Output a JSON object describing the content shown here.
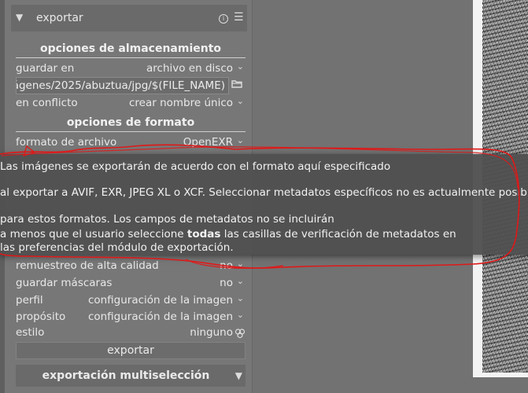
{
  "module": {
    "title": "exportar",
    "collapse_arrow": "▼"
  },
  "storage": {
    "section_title": "opciones de almacenamiento",
    "target_label": "guardar en",
    "target_value": "archivo en disco",
    "path_value": "ágenes/2025/abuztua/jpg/$(FILE_NAME)",
    "conflict_label": "en conflicto",
    "conflict_value": "crear nombre único"
  },
  "format": {
    "section_title": "opciones de formato",
    "file_format_label": "formato de archivo",
    "file_format_value": "OpenEXR"
  },
  "tooltip": {
    "line1": "Las imágenes se exportarán de acuerdo con el formato aquí especificado",
    "line2": "al exportar a AVIF, EXR, JPEG XL o XCF. Seleccionar metadatos específicos no es actualmente posible",
    "line3": "para estos formatos. Los campos de metadatos no se incluirán",
    "line4_before": "a menos que el usuario seleccione ",
    "line4_bold": "todas",
    "line4_after": " las casillas de verificación de metadatos en",
    "line5": "las preferencias del módulo de exportación."
  },
  "settings": {
    "hq_label": "remuestreo de alta calidad",
    "hq_value": "no",
    "masks_label": "guardar máscaras",
    "masks_value": "no",
    "profile_label": "perfil",
    "profile_value": "configuración de la imagen",
    "intent_label": "propósito",
    "intent_value": "configuración de la imagen",
    "style_label": "estilo",
    "style_value": "ninguno"
  },
  "export_button": "exportar",
  "multi": {
    "title": "exportación multiselección",
    "tri": "▼"
  },
  "colors": {
    "annotation_red": "#e01818",
    "panel_bg": "#777777"
  },
  "icons": [
    "info-icon",
    "menu-icon",
    "folder-icon",
    "chevron-down-icon",
    "style-icon"
  ]
}
